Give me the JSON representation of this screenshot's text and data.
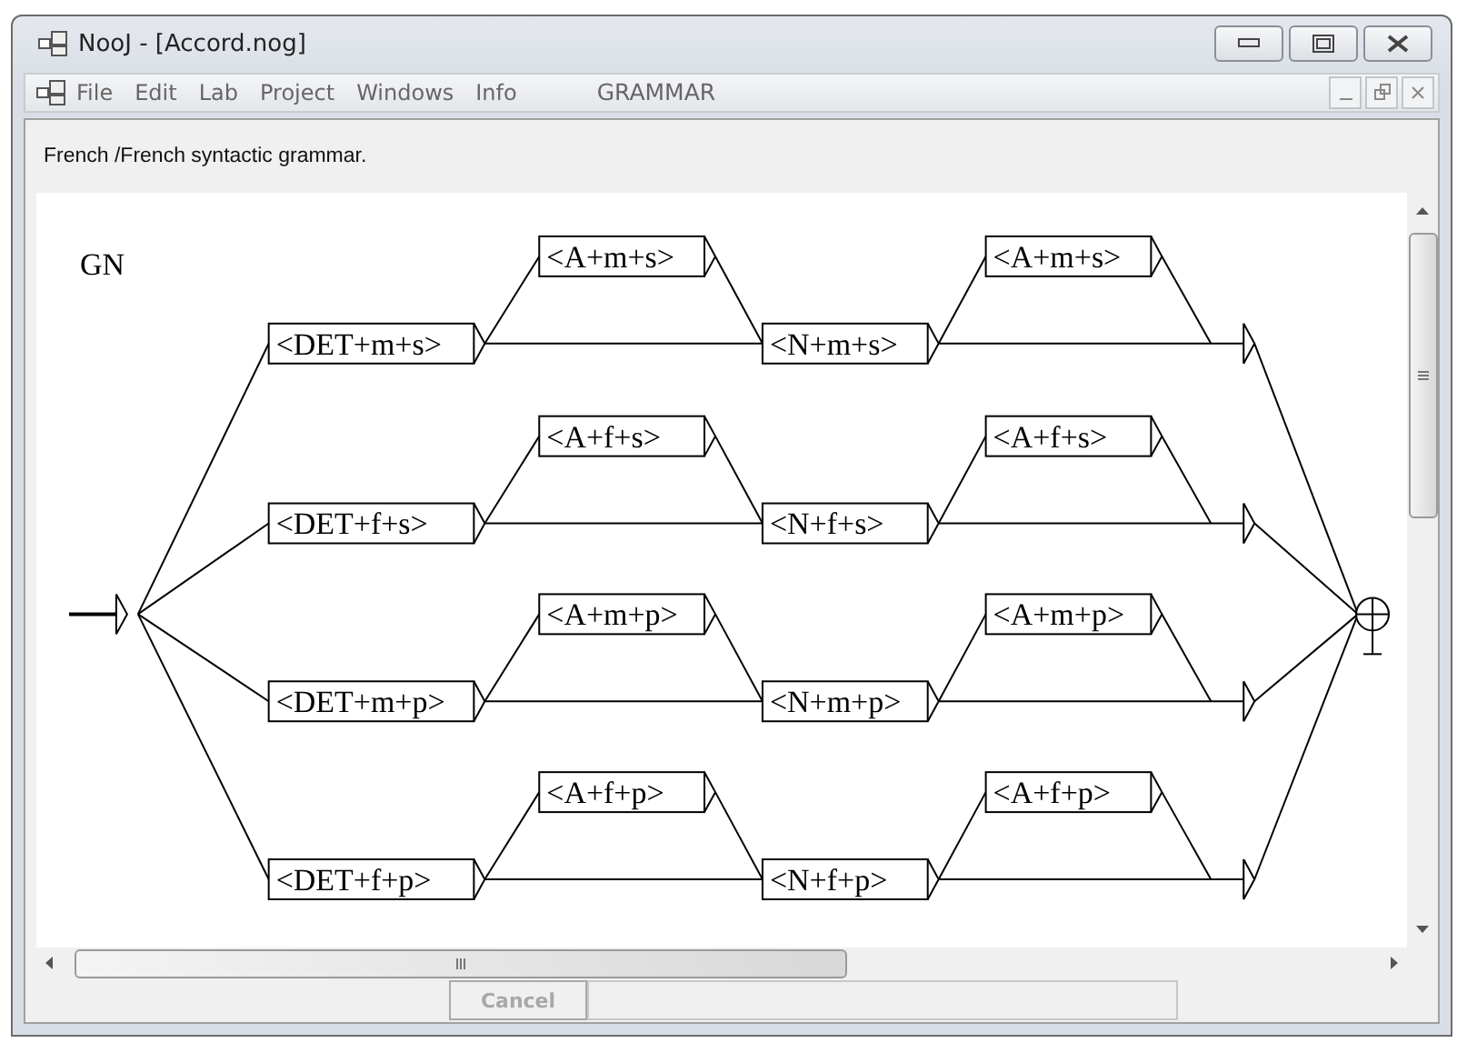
{
  "window": {
    "title": "NooJ - [Accord.nog]"
  },
  "menu": [
    "File",
    "Edit",
    "Lab",
    "Project",
    "Windows",
    "Info"
  ],
  "menu_context": "GRAMMAR",
  "comment": "French /French  syntactic grammar.",
  "graph": {
    "title": "GN",
    "rows": [
      {
        "determiner": "<DET+m+s>",
        "adjective_1": "<A+m+s>",
        "noun": "<N+m+s>",
        "adjective_2": "<A+m+s>"
      },
      {
        "determiner": "<DET+f+s>",
        "adjective_1": "<A+f+s>",
        "noun": "<N+f+s>",
        "adjective_2": "<A+f+s>"
      },
      {
        "determiner": "<DET+m+p>",
        "adjective_1": "<A+m+p>",
        "noun": "<N+m+p>",
        "adjective_2": "<A+m+p>"
      },
      {
        "determiner": "<DET+f+p>",
        "adjective_1": "<A+f+p>",
        "noun": "<N+f+p>",
        "adjective_2": "<A+f+p>"
      }
    ]
  },
  "cancel_button": {
    "label": "Cancel",
    "disabled": true
  }
}
